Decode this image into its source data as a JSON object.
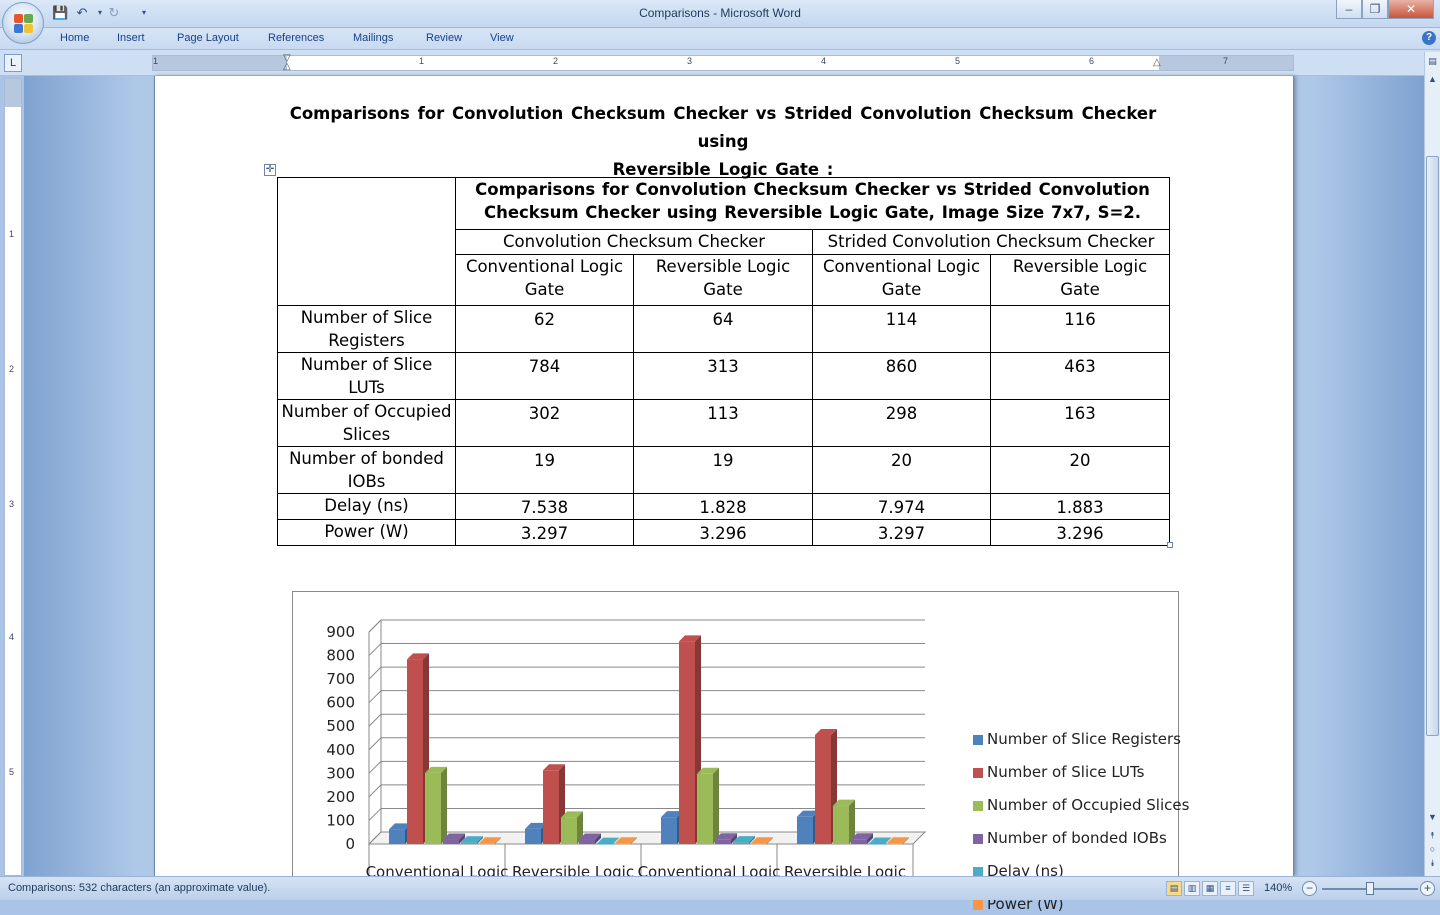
{
  "window": {
    "title": "Comparisons - Microsoft Word",
    "ribbon_tabs": [
      "Home",
      "Insert",
      "Page Layout",
      "References",
      "Mailings",
      "Review",
      "View"
    ]
  },
  "ruler": {
    "h_numbers": [
      "1",
      "1",
      "2",
      "3",
      "4",
      "5",
      "6",
      "7"
    ],
    "v_numbers": [
      "1",
      "2",
      "3",
      "4",
      "5"
    ]
  },
  "document": {
    "heading_line1": "Comparisons for Convolution Checksum Checker vs Strided Convolution Checksum Checker using",
    "heading_line2": "Reversible Logic Gate :",
    "table": {
      "caption_line1": "Comparisons for Convolution Checksum Checker vs Strided Convolution",
      "caption_line2": "Checksum Checker using Reversible Logic Gate, Image Size 7x7, S=2.",
      "group_headers": [
        "Convolution Checksum Checker",
        "Strided Convolution Checksum Checker"
      ],
      "sub_headers": [
        [
          "Conventional Logic",
          "Gate"
        ],
        [
          "Reversible Logic",
          "Gate"
        ],
        [
          "Conventional Logic",
          "Gate"
        ],
        [
          "Reversible Logic",
          "Gate"
        ]
      ],
      "rows": [
        {
          "label": [
            "Number of Slice",
            "Registers"
          ],
          "values": [
            "62",
            "64",
            "114",
            "116"
          ]
        },
        {
          "label": [
            "Number of Slice",
            "LUTs"
          ],
          "values": [
            "784",
            "313",
            "860",
            "463"
          ]
        },
        {
          "label": [
            "Number of Occupied",
            "Slices"
          ],
          "values": [
            "302",
            "113",
            "298",
            "163"
          ]
        },
        {
          "label": [
            "Number of bonded",
            "IOBs"
          ],
          "values": [
            "19",
            "19",
            "20",
            "20"
          ]
        },
        {
          "label": [
            "Delay (ns)"
          ],
          "values": [
            "7.538",
            "1.828",
            "7.974",
            "1.883"
          ]
        },
        {
          "label": [
            "Power (W)"
          ],
          "values": [
            "3.297",
            "3.296",
            "3.297",
            "3.296"
          ]
        }
      ]
    }
  },
  "chart_data": {
    "type": "bar",
    "style": "3d-clustered",
    "categories": [
      "Conventional Logic",
      "Reversible Logic",
      "Conventional Logic",
      "Reversible Logic"
    ],
    "yticks": [
      "900",
      "800",
      "700",
      "600",
      "500",
      "400",
      "300",
      "200",
      "100",
      "0"
    ],
    "ylim": [
      0,
      900
    ],
    "grid": true,
    "legend_position": "right",
    "series": [
      {
        "name": "Number of Slice Registers",
        "color": "#4f81bd",
        "values": [
          62,
          64,
          114,
          116
        ]
      },
      {
        "name": "Number of Slice LUTs",
        "color": "#c0504d",
        "values": [
          784,
          313,
          860,
          463
        ]
      },
      {
        "name": "Number of Occupied Slices",
        "color": "#9bbb59",
        "values": [
          302,
          113,
          298,
          163
        ]
      },
      {
        "name": "Number of bonded IOBs",
        "color": "#8064a2",
        "values": [
          19,
          19,
          20,
          20
        ]
      },
      {
        "name": "Delay (ns)",
        "color": "#4bacc6",
        "values": [
          7.538,
          1.828,
          7.974,
          1.883
        ]
      },
      {
        "name": "Power (W)",
        "color": "#f79646",
        "values": [
          3.297,
          3.296,
          3.297,
          3.296
        ]
      }
    ]
  },
  "status": {
    "text": "Comparisons: 532 characters (an approximate value).",
    "zoom": "140%"
  }
}
